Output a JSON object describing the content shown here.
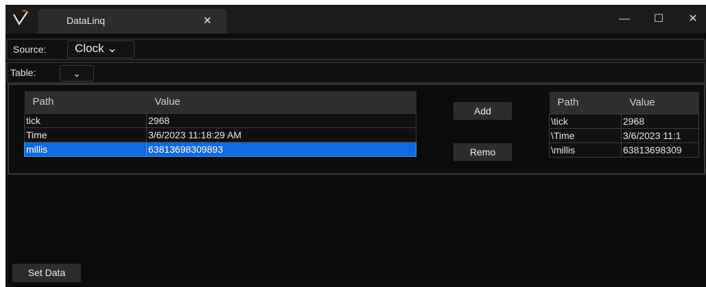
{
  "window": {
    "tab_title": "DataLinq",
    "tab_close": "✕",
    "min": "—",
    "max": "☐",
    "close": "✕"
  },
  "source": {
    "label": "Source:",
    "value": "Clock ⌄"
  },
  "table": {
    "label": "Table:",
    "value": "⌄"
  },
  "left_grid": {
    "headers": [
      "Path",
      "Value"
    ],
    "rows": [
      {
        "path": "tick",
        "value": "2968"
      },
      {
        "path": "Time",
        "value": "3/6/2023 11:18:29 AM"
      },
      {
        "path": "millis",
        "value": "63813698309893"
      }
    ]
  },
  "buttons": {
    "add": "Add",
    "remove": "Remo",
    "set_data": "Set Data"
  },
  "right_grid": {
    "headers": [
      "Path",
      "Value"
    ],
    "rows": [
      {
        "path": "\\tick",
        "value": "2968"
      },
      {
        "path": "\\Time",
        "value": "3/6/2023 11:1"
      },
      {
        "path": "\\millis",
        "value": "63813698309"
      }
    ]
  },
  "colors": {
    "selection": "#1169e0",
    "background": "#0b0b0b",
    "header": "#2e2e2e"
  }
}
